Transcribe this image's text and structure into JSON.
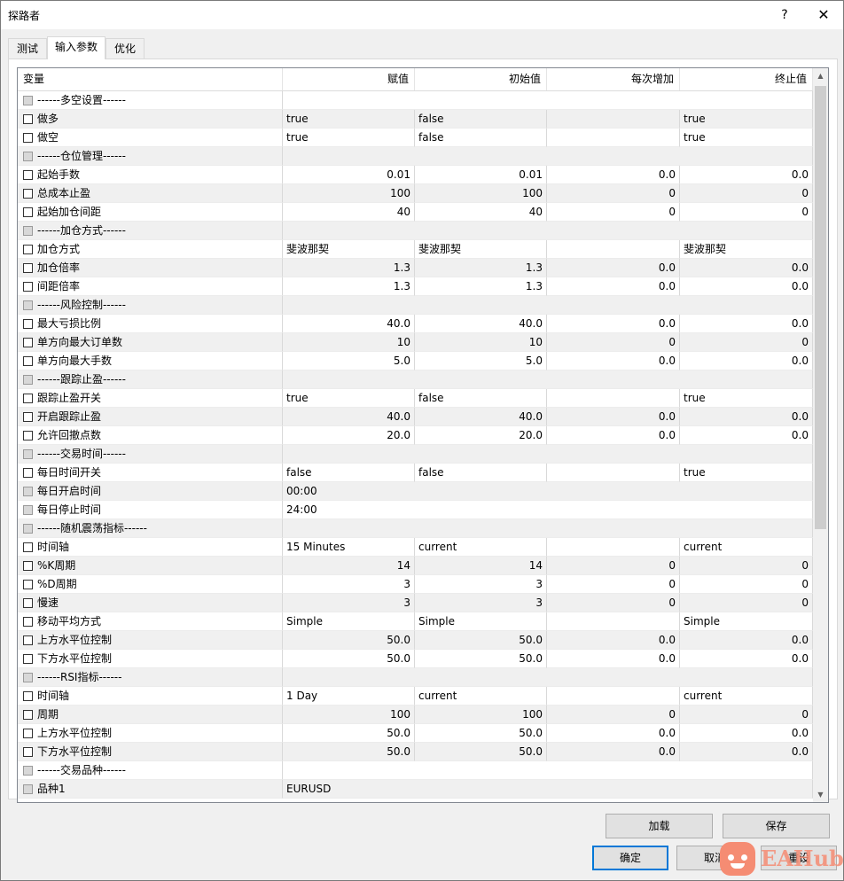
{
  "window": {
    "title": "探路者",
    "help": "?",
    "close": "✕"
  },
  "tabs": [
    {
      "label": "测试"
    },
    {
      "label": "输入参数"
    },
    {
      "label": "优化"
    }
  ],
  "grid": {
    "columns": [
      "变量",
      "赋值",
      "初始值",
      "每次增加",
      "终止值"
    ],
    "rows": [
      {
        "name": "------多空设置------",
        "v": "",
        "s": "",
        "i": "",
        "e": "",
        "hdr": true
      },
      {
        "name": "做多",
        "v": "true",
        "s": "false",
        "i": "",
        "e": "true",
        "t": "txt"
      },
      {
        "name": "做空",
        "v": "true",
        "s": "false",
        "i": "",
        "e": "true",
        "t": "txt"
      },
      {
        "name": "------仓位管理------",
        "v": "",
        "s": "",
        "i": "",
        "e": "",
        "hdr": true
      },
      {
        "name": "起始手数",
        "v": "0.01",
        "s": "0.01",
        "i": "0.0",
        "e": "0.0",
        "t": "num"
      },
      {
        "name": "总成本止盈",
        "v": "100",
        "s": "100",
        "i": "0",
        "e": "0",
        "t": "num"
      },
      {
        "name": "起始加仓间距",
        "v": "40",
        "s": "40",
        "i": "0",
        "e": "0",
        "t": "num"
      },
      {
        "name": "------加仓方式------",
        "v": "",
        "s": "",
        "i": "",
        "e": "",
        "hdr": true
      },
      {
        "name": "加仓方式",
        "v": "斐波那契",
        "s": "斐波那契",
        "i": "",
        "e": "斐波那契",
        "t": "txt"
      },
      {
        "name": "加仓倍率",
        "v": "1.3",
        "s": "1.3",
        "i": "0.0",
        "e": "0.0",
        "t": "num"
      },
      {
        "name": "间距倍率",
        "v": "1.3",
        "s": "1.3",
        "i": "0.0",
        "e": "0.0",
        "t": "num"
      },
      {
        "name": "------风险控制------",
        "v": "",
        "s": "",
        "i": "",
        "e": "",
        "hdr": true
      },
      {
        "name": "最大亏损比例",
        "v": "40.0",
        "s": "40.0",
        "i": "0.0",
        "e": "0.0",
        "t": "num"
      },
      {
        "name": "单方向最大订单数",
        "v": "10",
        "s": "10",
        "i": "0",
        "e": "0",
        "t": "num"
      },
      {
        "name": "单方向最大手数",
        "v": "5.0",
        "s": "5.0",
        "i": "0.0",
        "e": "0.0",
        "t": "num"
      },
      {
        "name": "------跟踪止盈------",
        "v": "",
        "s": "",
        "i": "",
        "e": "",
        "hdr": true
      },
      {
        "name": "跟踪止盈开关",
        "v": "true",
        "s": "false",
        "i": "",
        "e": "true",
        "t": "txt"
      },
      {
        "name": "开启跟踪止盈",
        "v": "40.0",
        "s": "40.0",
        "i": "0.0",
        "e": "0.0",
        "t": "num"
      },
      {
        "name": "允许回撤点数",
        "v": "20.0",
        "s": "20.0",
        "i": "0.0",
        "e": "0.0",
        "t": "num"
      },
      {
        "name": "------交易时间------",
        "v": "",
        "s": "",
        "i": "",
        "e": "",
        "hdr": true
      },
      {
        "name": "每日时间开关",
        "v": "false",
        "s": "false",
        "i": "",
        "e": "true",
        "t": "txt"
      },
      {
        "name": "每日开启时间",
        "v": "00:00",
        "s": "",
        "i": "",
        "e": "",
        "t": "txt",
        "span": true,
        "grey": true
      },
      {
        "name": "每日停止时间",
        "v": "24:00",
        "s": "",
        "i": "",
        "e": "",
        "t": "txt",
        "span": true,
        "grey": true
      },
      {
        "name": "------随机震荡指标------",
        "v": "",
        "s": "",
        "i": "",
        "e": "",
        "hdr": true
      },
      {
        "name": "时间轴",
        "v": "15 Minutes",
        "s": "current",
        "i": "",
        "e": "current",
        "t": "txt"
      },
      {
        "name": "%K周期",
        "v": "14",
        "s": "14",
        "i": "0",
        "e": "0",
        "t": "num"
      },
      {
        "name": "%D周期",
        "v": "3",
        "s": "3",
        "i": "0",
        "e": "0",
        "t": "num"
      },
      {
        "name": "慢速",
        "v": "3",
        "s": "3",
        "i": "0",
        "e": "0",
        "t": "num"
      },
      {
        "name": "移动平均方式",
        "v": "Simple",
        "s": "Simple",
        "i": "",
        "e": "Simple",
        "t": "txt"
      },
      {
        "name": "上方水平位控制",
        "v": "50.0",
        "s": "50.0",
        "i": "0.0",
        "e": "0.0",
        "t": "num"
      },
      {
        "name": "下方水平位控制",
        "v": "50.0",
        "s": "50.0",
        "i": "0.0",
        "e": "0.0",
        "t": "num"
      },
      {
        "name": "------RSI指标------",
        "v": "",
        "s": "",
        "i": "",
        "e": "",
        "hdr": true
      },
      {
        "name": "时间轴",
        "v": "1 Day",
        "s": "current",
        "i": "",
        "e": "current",
        "t": "txt"
      },
      {
        "name": "周期",
        "v": "100",
        "s": "100",
        "i": "0",
        "e": "0",
        "t": "num"
      },
      {
        "name": "上方水平位控制",
        "v": "50.0",
        "s": "50.0",
        "i": "0.0",
        "e": "0.0",
        "t": "num"
      },
      {
        "name": "下方水平位控制",
        "v": "50.0",
        "s": "50.0",
        "i": "0.0",
        "e": "0.0",
        "t": "num"
      },
      {
        "name": "------交易品种------",
        "v": "",
        "s": "",
        "i": "",
        "e": "",
        "hdr": true
      },
      {
        "name": "品种1",
        "v": "EURUSD",
        "s": "",
        "i": "",
        "e": "",
        "t": "txt",
        "span": true,
        "grey": true
      }
    ]
  },
  "buttons": {
    "load": "加载",
    "save": "保存",
    "ok": "确定",
    "cancel": "取消",
    "reset": "重设"
  },
  "watermark": {
    "text": "EAHub"
  }
}
